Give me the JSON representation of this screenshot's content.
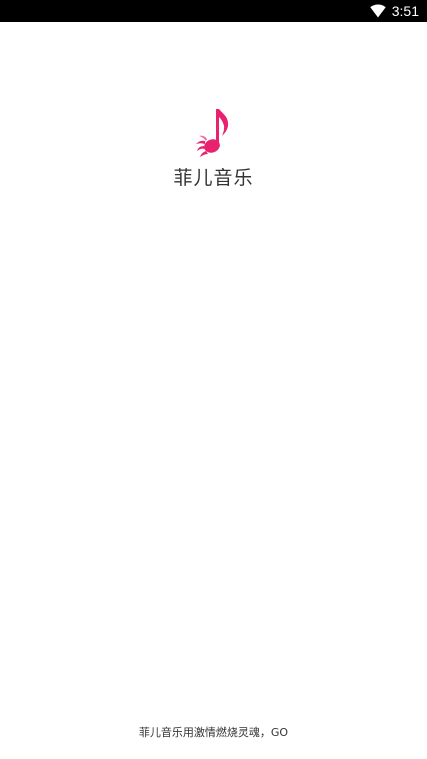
{
  "status_bar": {
    "time": "3:51",
    "icons": [
      "wifi-icon"
    ]
  },
  "splash": {
    "logo_icon": "music-note-flame-icon",
    "app_name": "菲儿音乐",
    "tagline": "菲儿音乐用激情燃烧灵魂，GO"
  },
  "colors": {
    "brand_pink": "#e8226f",
    "text": "#333333",
    "status_bar_bg": "#000000",
    "background": "#ffffff"
  }
}
